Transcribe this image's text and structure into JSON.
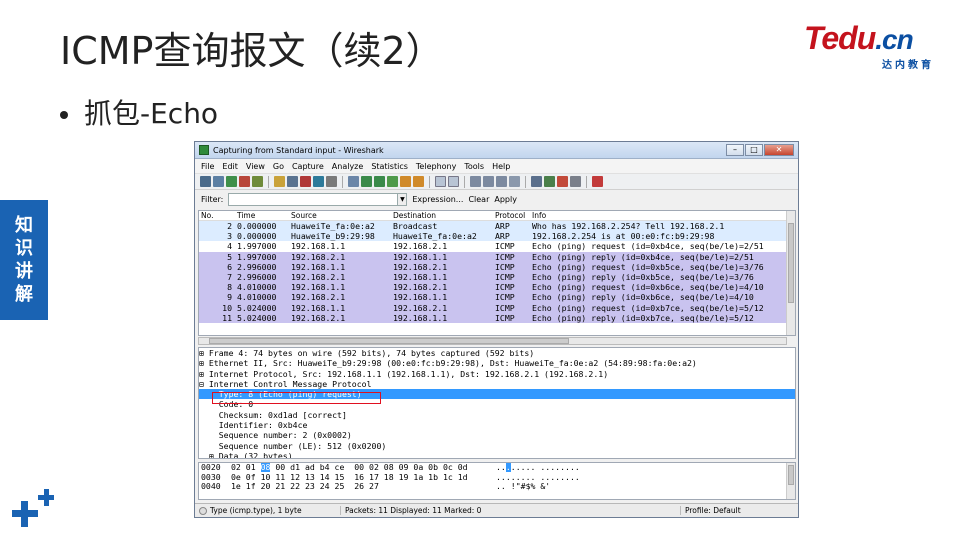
{
  "slide": {
    "title": "ICMP查询报文（续2）",
    "bullet": "抓包-Echo",
    "side_tab": [
      "知",
      "识",
      "讲",
      "解"
    ],
    "logo_main": "Tedu",
    "logo_cn": ".cn",
    "logo_sub": "达内教育",
    "brand_color": "#1a63b3",
    "logo_red": "#c4131d"
  },
  "window": {
    "title": "Capturing from Standard input - Wireshark",
    "min": "–",
    "max": "□",
    "close": "✕"
  },
  "menu": [
    "File",
    "Edit",
    "View",
    "Go",
    "Capture",
    "Analyze",
    "Statistics",
    "Telephony",
    "Tools",
    "Help"
  ],
  "filter": {
    "label": "Filter:",
    "expression": "Expression...",
    "clear": "Clear",
    "apply": "Apply",
    "value": ""
  },
  "columns": [
    "No.",
    "Time",
    "Source",
    "Destination",
    "Protocol",
    "Info"
  ],
  "packets": [
    {
      "no": "2",
      "time": "0.000000",
      "src": "HuaweiTe_fa:0e:a2",
      "dst": "Broadcast",
      "proto": "ARP",
      "info": "Who has 192.168.2.254?  Tell 192.168.2.1",
      "color": "#dcecff"
    },
    {
      "no": "3",
      "time": "0.000000",
      "src": "HuaweiTe_b9:29:98",
      "dst": "HuaweiTe_fa:0e:a2",
      "proto": "ARP",
      "info": "192.168.2.254 is at 00:e0:fc:b9:29:98",
      "color": "#dcecff"
    },
    {
      "no": "4",
      "time": "1.997000",
      "src": "192.168.1.1",
      "dst": "192.168.2.1",
      "proto": "ICMP",
      "info": "Echo (ping) request  (id=0xb4ce, seq(be/le)=2/51",
      "color": "#ffffff"
    },
    {
      "no": "5",
      "time": "1.997000",
      "src": "192.168.2.1",
      "dst": "192.168.1.1",
      "proto": "ICMP",
      "info": "Echo (ping) reply    (id=0xb4ce, seq(be/le)=2/51",
      "color": "#c9c3ef"
    },
    {
      "no": "6",
      "time": "2.996000",
      "src": "192.168.1.1",
      "dst": "192.168.2.1",
      "proto": "ICMP",
      "info": "Echo (ping) request  (id=0xb5ce, seq(be/le)=3/76",
      "color": "#c9c3ef"
    },
    {
      "no": "7",
      "time": "2.996000",
      "src": "192.168.2.1",
      "dst": "192.168.1.1",
      "proto": "ICMP",
      "info": "Echo (ping) reply    (id=0xb5ce, seq(be/le)=3/76",
      "color": "#c9c3ef"
    },
    {
      "no": "8",
      "time": "4.010000",
      "src": "192.168.1.1",
      "dst": "192.168.2.1",
      "proto": "ICMP",
      "info": "Echo (ping) request  (id=0xb6ce, seq(be/le)=4/10",
      "color": "#c9c3ef"
    },
    {
      "no": "9",
      "time": "4.010000",
      "src": "192.168.2.1",
      "dst": "192.168.1.1",
      "proto": "ICMP",
      "info": "Echo (ping) reply    (id=0xb6ce, seq(be/le)=4/10",
      "color": "#c9c3ef"
    },
    {
      "no": "10",
      "time": "5.024000",
      "src": "192.168.1.1",
      "dst": "192.168.2.1",
      "proto": "ICMP",
      "info": "Echo (ping) request  (id=0xb7ce, seq(be/le)=5/12",
      "color": "#c9c3ef"
    },
    {
      "no": "11",
      "time": "5.024000",
      "src": "192.168.2.1",
      "dst": "192.168.1.1",
      "proto": "ICMP",
      "info": "Echo (ping) reply    (id=0xb7ce, seq(be/le)=5/12",
      "color": "#c9c3ef"
    }
  ],
  "details": [
    {
      "text": "⊞ Frame 4: 74 bytes on wire (592 bits), 74 bytes captured (592 bits)",
      "sel": false
    },
    {
      "text": "⊞ Ethernet II, Src: HuaweiTe_b9:29:98 (00:e0:fc:b9:29:98), Dst: HuaweiTe_fa:0e:a2 (54:89:98:fa:0e:a2)",
      "sel": false
    },
    {
      "text": "⊞ Internet Protocol, Src: 192.168.1.1 (192.168.1.1), Dst: 192.168.2.1 (192.168.2.1)",
      "sel": false
    },
    {
      "text": "⊟ Internet Control Message Protocol",
      "sel": false
    },
    {
      "text": "    Type: 8 (Echo (ping) request)",
      "sel": true
    },
    {
      "text": "    Code: 0",
      "sel": false
    },
    {
      "text": "    Checksum: 0xd1ad [correct]",
      "sel": false
    },
    {
      "text": "    Identifier: 0xb4ce",
      "sel": false
    },
    {
      "text": "    Sequence number: 2 (0x0002)",
      "sel": false
    },
    {
      "text": "    Sequence number (LE): 512 (0x0200)",
      "sel": false
    },
    {
      "text": "  ⊞ Data (32 bytes)",
      "sel": false
    }
  ],
  "hex": [
    {
      "off": "0020",
      "pre": "02 01 ",
      "hl": "08",
      "post": " 00 d1 ad b4 ce  00 02 08 09 0a 0b 0c 0d",
      "apre": "..",
      "ahl": ".",
      "apost": "..... ........"
    },
    {
      "off": "0030",
      "pre": "0e 0f 10 11 12 13 14 15  16 17 18 19 1a 1b 1c 1d",
      "hl": "",
      "post": "",
      "apre": "........ ........",
      "ahl": "",
      "apost": ""
    },
    {
      "off": "0040",
      "pre": "1e 1f 20 21 22 23 24 25  26 27",
      "hl": "",
      "post": "",
      "apre": ".. !\"#$% &'",
      "ahl": "",
      "apost": ""
    }
  ],
  "status": {
    "field": "Type (icmp.type), 1 byte",
    "packets": "Packets: 11 Displayed: 11 Marked: 0",
    "profile": "Profile: Default"
  }
}
